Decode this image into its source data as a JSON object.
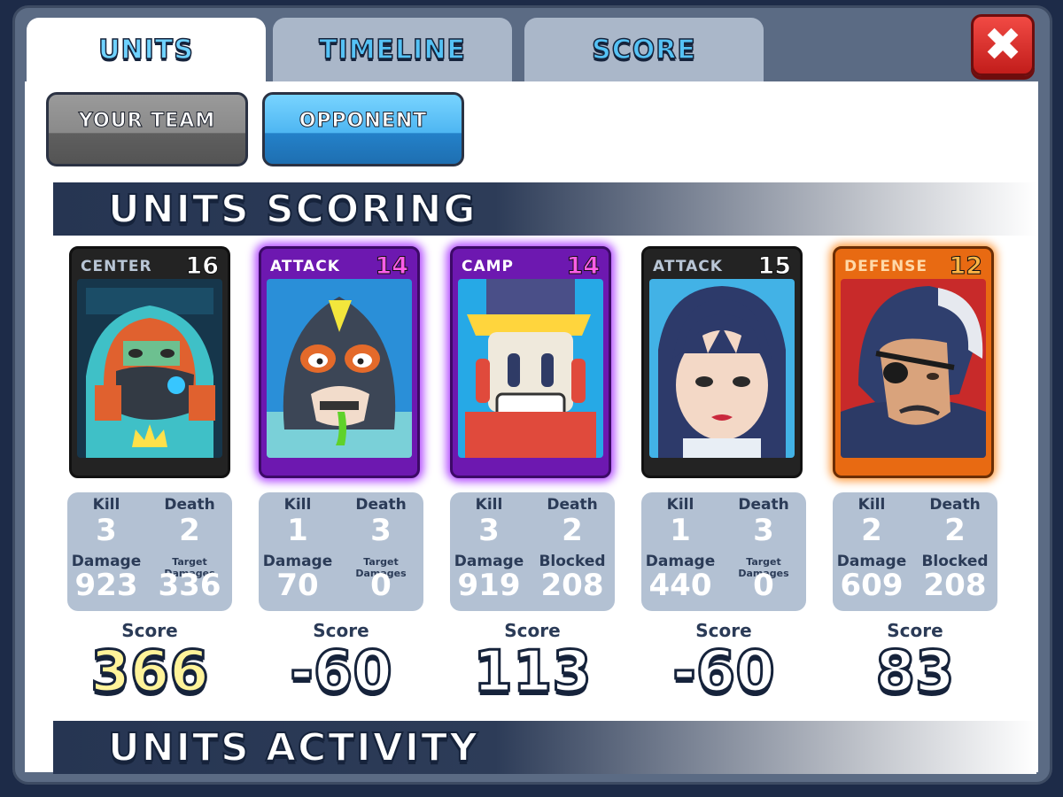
{
  "tabs": [
    {
      "label": "Units"
    },
    {
      "label": "Timeline"
    },
    {
      "label": "Score"
    }
  ],
  "close_icon": "close-x-icon",
  "team_toggle": {
    "your_team": "Your Team",
    "opponent": "Opponent"
  },
  "sections": {
    "scoring": "Units Scoring",
    "activity": "Units Activity"
  },
  "units": [
    {
      "role": "CENTER",
      "level": "16",
      "rarity": "common",
      "kill_label": "Kill",
      "kill": "3",
      "death_label": "Death",
      "death": "2",
      "damage_label": "Damage",
      "damage": "923",
      "stat4_label": "Target Damages",
      "stat4": "336",
      "score_label": "Score",
      "score": "366",
      "score_color": "#fff39a"
    },
    {
      "role": "ATTACK",
      "level": "14",
      "rarity": "epic",
      "kill_label": "Kill",
      "kill": "1",
      "death_label": "Death",
      "death": "3",
      "damage_label": "Damage",
      "damage": "70",
      "stat4_label": "Target Damages",
      "stat4": "0",
      "score_label": "Score",
      "score": "-60",
      "score_color": "#ffffff"
    },
    {
      "role": "CAMP",
      "level": "14",
      "rarity": "epic",
      "kill_label": "Kill",
      "kill": "3",
      "death_label": "Death",
      "death": "2",
      "damage_label": "Damage",
      "damage": "919",
      "stat4_label": "Blocked",
      "stat4": "208",
      "score_label": "Score",
      "score": "113",
      "score_color": "#ffffff"
    },
    {
      "role": "ATTACK",
      "level": "15",
      "rarity": "common",
      "kill_label": "Kill",
      "kill": "1",
      "death_label": "Death",
      "death": "3",
      "damage_label": "Damage",
      "damage": "440",
      "stat4_label": "Target Damages",
      "stat4": "0",
      "score_label": "Score",
      "score": "-60",
      "score_color": "#ffffff"
    },
    {
      "role": "DEFENSE",
      "level": "12",
      "rarity": "legendary",
      "kill_label": "Kill",
      "kill": "2",
      "death_label": "Death",
      "death": "2",
      "damage_label": "Damage",
      "damage": "609",
      "stat4_label": "Blocked",
      "stat4": "208",
      "score_label": "Score",
      "score": "83",
      "score_color": "#ffffff"
    }
  ]
}
